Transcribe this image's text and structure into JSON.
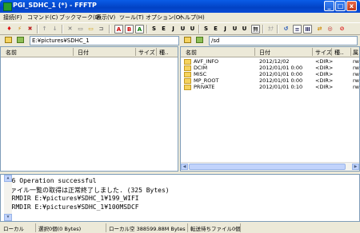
{
  "window": {
    "title": "PGI_SDHC_1 (*) - FFFTP",
    "minimize": "_",
    "maximize": "□",
    "close": "x"
  },
  "menu": [
    "接続(F)",
    "コマンド(C)",
    "ブックマーク(B)",
    "表示(V)",
    "ツール(T)",
    "オプション(O)",
    "ヘルプ(H)"
  ],
  "toolbar": {
    "icon_names": [
      "connect-icon",
      "quick-connect-icon",
      "disconnect-icon",
      "upload-icon",
      "download-icon",
      "delete-icon",
      "rename-icon",
      "mkdir-icon",
      "up-dir-icon",
      "ascii-mode-icon",
      "binary-mode-icon",
      "auto-mode-icon",
      "sort-icon",
      "list-view-icon",
      "detail-view-icon",
      "refresh-icon",
      "sync-icon",
      "abort-icon"
    ],
    "kanji_local": [
      "S",
      "E",
      "J",
      "U",
      "U"
    ],
    "kanji_remote": [
      "S",
      "E",
      "J",
      "U",
      "U"
    ],
    "mu_label": "無",
    "kana_label": "ｶﾅ"
  },
  "local": {
    "path": "E:¥pictures¥SDHC_1",
    "columns": {
      "name": "名前",
      "date": "日付",
      "size": "サイズ",
      "type": "種.."
    }
  },
  "remote": {
    "path": "/sd",
    "columns": {
      "name": "名前",
      "date": "日付",
      "size": "サイズ",
      "attr": "属"
    },
    "files": [
      {
        "name": "AVF_INFO",
        "date": "2012/12/02",
        "size": "<DIR>",
        "attr": "rw"
      },
      {
        "name": "DCIM",
        "date": "2012/01/01  0:00",
        "size": "<DIR>",
        "attr": "rw"
      },
      {
        "name": "MISC",
        "date": "2012/01/01  0:00",
        "size": "<DIR>",
        "attr": "rw"
      },
      {
        "name": "MP_ROOT",
        "date": "2012/01/01  0:00",
        "size": "<DIR>",
        "attr": "rw"
      },
      {
        "name": "PRIVATE",
        "date": "2012/01/01  0:10",
        "size": "<DIR>",
        "attr": "rw"
      }
    ]
  },
  "log": [
    "226 Operation successful",
    "ファイル一覧の取得は正常終了しました. (325 Bytes)",
    ">>RMDIR E:¥pictures¥SDHC_1¥199_WIFI",
    ">>RMDIR E:¥pictures¥SDHC_1¥100MSDCF"
  ],
  "status": {
    "local": "ローカル",
    "selected": "選択0個(0 Bytes)",
    "free": "ローカル空 388599.88M Bytes",
    "queue": "転送待ちファイル0個"
  }
}
